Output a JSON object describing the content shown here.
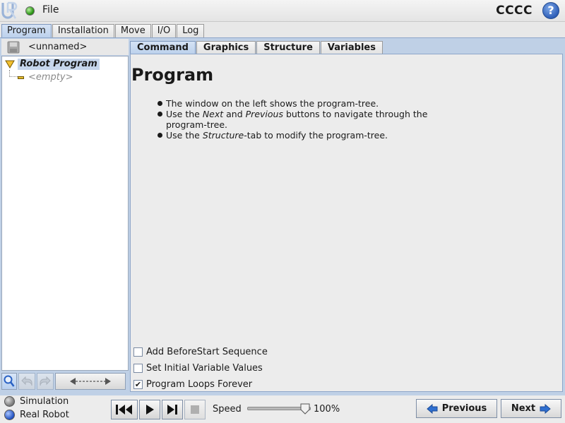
{
  "topbar": {
    "file_label": "File",
    "robot_name": "CCCC",
    "help_symbol": "?",
    "status_color": "#2f9a1a"
  },
  "main_tabs": [
    "Program",
    "Installation",
    "Move",
    "I/O",
    "Log"
  ],
  "main_tab_active": "Program",
  "left_panel": {
    "program_name": "<unnamed>",
    "tree": {
      "root_label": "Robot Program",
      "child_label": "<empty>"
    }
  },
  "sub_tabs": [
    "Command",
    "Graphics",
    "Structure",
    "Variables"
  ],
  "sub_tab_active": "Command",
  "content": {
    "title": "Program",
    "bullets": [
      {
        "before": "The window on the left shows the program-tree.",
        "em": "",
        "after": "",
        "em2": "",
        "after2": ""
      },
      {
        "before": "Use the ",
        "em": "Next",
        "after": " and ",
        "em2": "Previous",
        "after2": " buttons to navigate through the program-tree."
      },
      {
        "before": "Use the ",
        "em": "Structure",
        "after": "-tab to modify the program-tree.",
        "em2": "",
        "after2": ""
      }
    ],
    "options": [
      {
        "label": "Add BeforeStart Sequence",
        "checked": false
      },
      {
        "label": "Set Initial Variable Values",
        "checked": false
      },
      {
        "label": "Program Loops Forever",
        "checked": true
      }
    ]
  },
  "bottombar": {
    "mode_simulation": "Simulation",
    "mode_real": "Real Robot",
    "speed_label": "Speed",
    "speed_value": "100%",
    "speed_fraction": 1.0,
    "previous_label": "Previous",
    "next_label": "Next"
  },
  "colors": {
    "accent": "#bcd1ec",
    "nav_arrow": "#2f6fd0"
  }
}
